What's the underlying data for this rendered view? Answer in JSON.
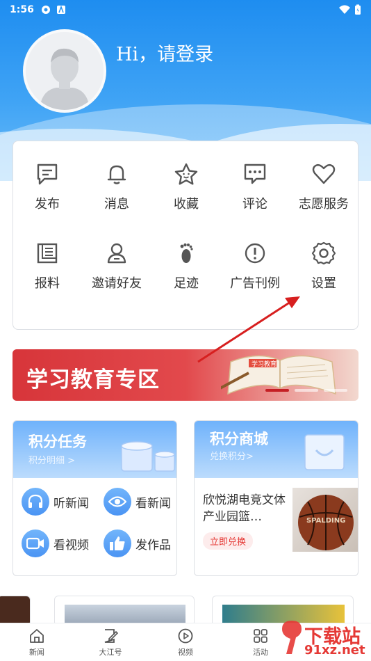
{
  "status_bar": {
    "time": "1:56"
  },
  "profile": {
    "greeting": "Hi，请登录"
  },
  "menu": {
    "items": [
      {
        "label": "发布",
        "icon": "post-icon"
      },
      {
        "label": "消息",
        "icon": "bell-icon"
      },
      {
        "label": "收藏",
        "icon": "star-icon"
      },
      {
        "label": "评论",
        "icon": "comment-icon"
      },
      {
        "label": "志愿服务",
        "icon": "heart-icon"
      },
      {
        "label": "报料",
        "icon": "report-icon"
      },
      {
        "label": "邀请好友",
        "icon": "invite-icon"
      },
      {
        "label": "足迹",
        "icon": "footprint-icon"
      },
      {
        "label": "广告刊例",
        "icon": "exclamation-icon"
      },
      {
        "label": "设置",
        "icon": "gear-icon"
      }
    ]
  },
  "banner": {
    "title": "学习教育专区",
    "book_caption": "学习教育"
  },
  "points_task": {
    "title": "积分任务",
    "subtitle": "积分明细 >",
    "tasks": [
      {
        "label": "听新闻",
        "icon": "headphones-icon"
      },
      {
        "label": "看新闻",
        "icon": "eye-icon"
      },
      {
        "label": "看视频",
        "icon": "video-camera-icon"
      },
      {
        "label": "发作品",
        "icon": "thumbs-up-icon"
      }
    ]
  },
  "points_mall": {
    "title": "积分商城",
    "subtitle": "兑换积分>",
    "product_name": "欣悦湖电竞文体产业园篮…",
    "redeem_label": "立即兑换",
    "product_brand": "SPALDING"
  },
  "bottom_nav": {
    "items": [
      {
        "label": "新闻",
        "icon": "home-icon"
      },
      {
        "label": "大江号",
        "icon": "edit-icon"
      },
      {
        "label": "视频",
        "icon": "play-icon"
      },
      {
        "label": "活动",
        "icon": "grid-icon"
      }
    ]
  },
  "watermark": {
    "brand": "下载站",
    "domain": "91xz.net"
  },
  "colors": {
    "header_blue": "#1e8df0",
    "banner_red": "#d7353a",
    "arrow_red": "#d71f1f",
    "card_blue": "#6fb2fb"
  }
}
